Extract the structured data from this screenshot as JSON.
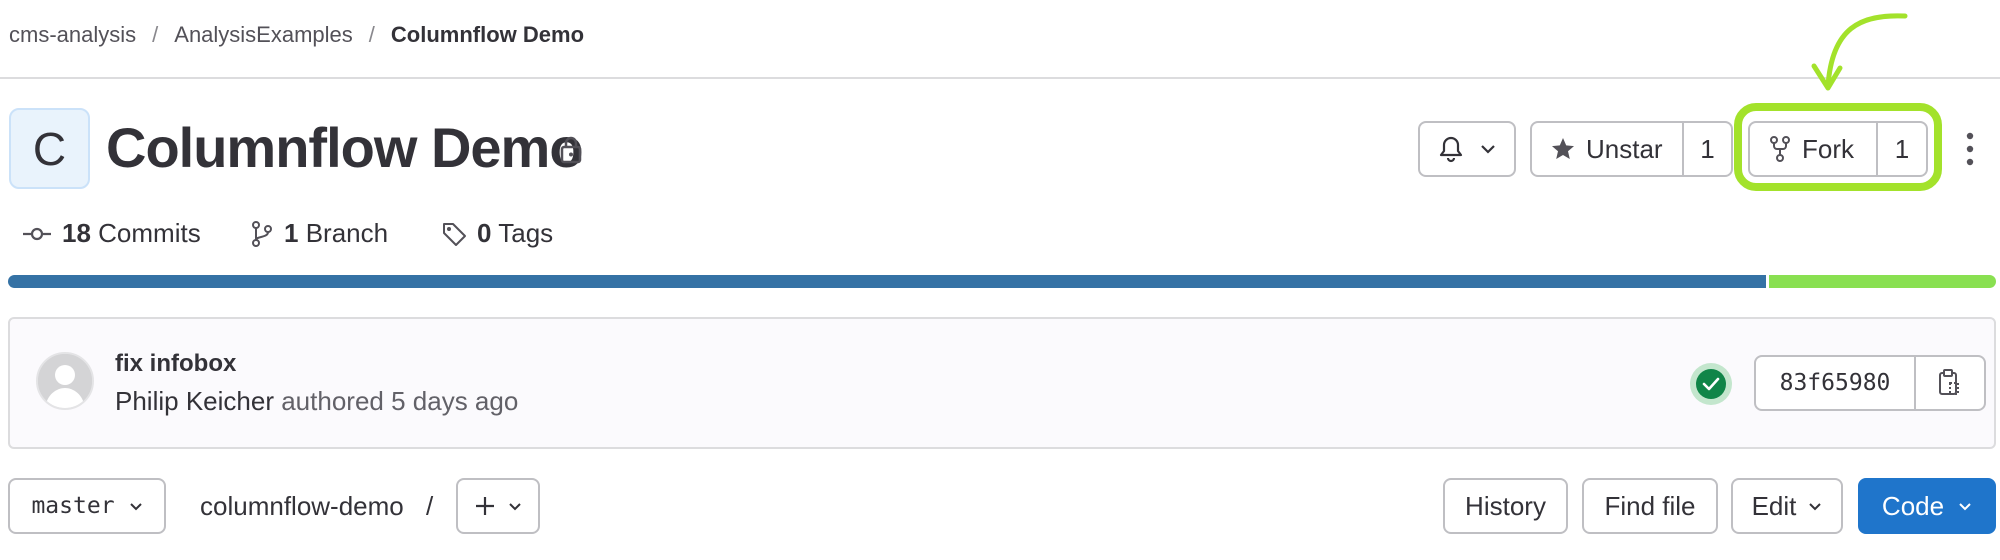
{
  "breadcrumb": {
    "items": [
      "cms-analysis",
      "AnalysisExamples"
    ],
    "separator": "/",
    "current": "Columnflow Demo"
  },
  "project": {
    "avatar_letter": "C",
    "title": "Columnflow Demo",
    "visibility_icon": "lock-icon"
  },
  "actions": {
    "notifications_icon": "bell-icon",
    "star_label": "Unstar",
    "star_count": "1",
    "fork_label": "Fork",
    "fork_count": "1",
    "more_icon": "kebab-icon"
  },
  "stats": [
    {
      "icon": "commit-icon",
      "count": "18",
      "label": "Commits"
    },
    {
      "icon": "branch-icon",
      "count": "1",
      "label": "Branch"
    },
    {
      "icon": "tag-icon",
      "count": "0",
      "label": "Tags"
    }
  ],
  "languages": [
    {
      "color": "#3572a5",
      "fraction": 0.8855
    },
    {
      "color": "#89e051",
      "fraction": 0.1145
    }
  ],
  "last_commit": {
    "title": "fix infobox",
    "author": "Philip Keicher",
    "action": "authored",
    "time": "5 days ago",
    "status": "passed",
    "sha": "83f65980"
  },
  "repo": {
    "branch": "master",
    "path": "columnflow-demo",
    "path_separator": "/",
    "history_label": "History",
    "find_file_label": "Find file",
    "edit_label": "Edit",
    "code_label": "Code"
  },
  "colors": {
    "highlight": "#a3e22b",
    "primary": "#1f75cb",
    "success": "#108548"
  }
}
